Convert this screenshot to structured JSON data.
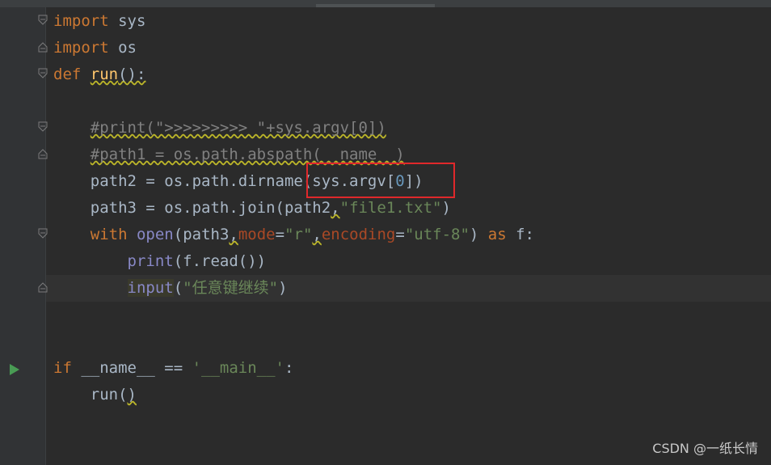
{
  "editor": {
    "language": "python",
    "lines": [
      {
        "text": "import sys"
      },
      {
        "text": "import os"
      },
      {
        "text": "def run():"
      },
      {
        "text": ""
      },
      {
        "text": "    #print(\">>>>>>>>> \"+sys.argv[0])"
      },
      {
        "text": "    #path1 = os.path.abspath(__name__)"
      },
      {
        "text": "    path2 = os.path.dirname(sys.argv[0])"
      },
      {
        "text": "    path3 = os.path.join(path2,\"file1.txt\")"
      },
      {
        "text": "    with open(path3,mode=\"r\",encoding=\"utf-8\") as f:"
      },
      {
        "text": "        print(f.read())"
      },
      {
        "text": "        input(\"任意键继续\")"
      },
      {
        "text": ""
      },
      {
        "text": ""
      },
      {
        "text": "if __name__ == '__main__':"
      },
      {
        "text": "    run()"
      }
    ],
    "highlight_annotation": "sys.argv[0])",
    "colors": {
      "background": "#2b2b2b",
      "gutter": "#313335",
      "keyword": "#cc7832",
      "function_def": "#ffc66d",
      "builtin": "#8888c6",
      "string": "#6a8759",
      "number": "#6897bb",
      "comment": "#808080",
      "parameter": "#aa4926",
      "annotation_box": "#e0282b",
      "run_icon": "#499c54"
    },
    "gutter_icons": [
      "fold-icon",
      "fold-icon",
      "fold-icon",
      "fold-icon",
      "fold-icon",
      "fold-icon",
      "fold-icon",
      "run-icon"
    ]
  },
  "watermark": "CSDN @一纸长情"
}
